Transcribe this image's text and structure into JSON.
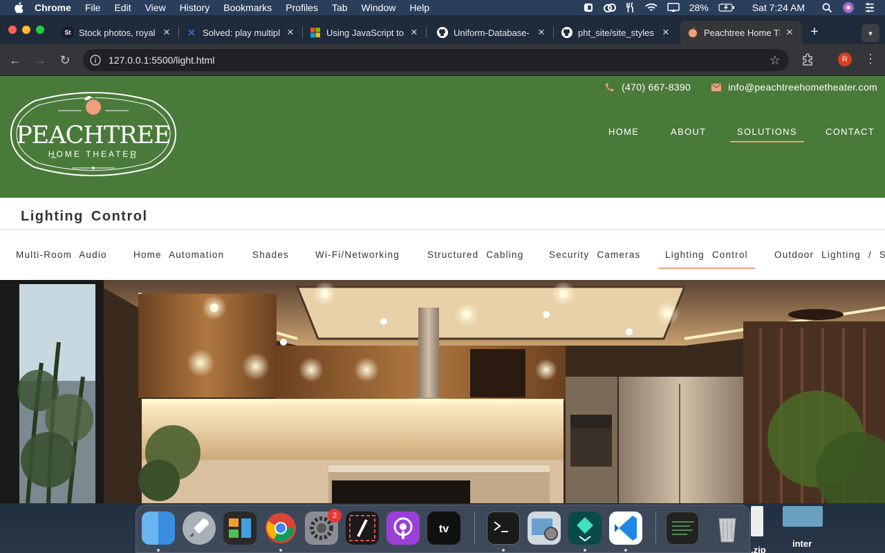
{
  "menubar": {
    "app": "Chrome",
    "menus": [
      "File",
      "Edit",
      "View",
      "History",
      "Bookmarks",
      "Profiles",
      "Tab",
      "Window",
      "Help"
    ],
    "battery": "28%",
    "clock": "Sat 7:24 AM"
  },
  "tabs": [
    {
      "title": "Stock photos, royal",
      "favicon": "St",
      "favicon_color": "#1a1a2e"
    },
    {
      "title": "Solved: play multipl",
      "favicon": "✕",
      "favicon_color": "#2a6fdb"
    },
    {
      "title": "Using JavaScript to",
      "favicon": "ms",
      "favicon_color": "#ffffff"
    },
    {
      "title": "Uniform-Database-",
      "favicon": "gh",
      "favicon_color": "#ffffff"
    },
    {
      "title": "pht_site/site_styles",
      "favicon": "gh",
      "favicon_color": "#ffffff"
    },
    {
      "title": "Peachtree Home Th",
      "favicon": "peach",
      "favicon_color": "#f0a07a"
    }
  ],
  "address": {
    "url": "127.0.0.1:5500/light.html",
    "avatar_letter": "R"
  },
  "site": {
    "logo_text_main": "PEACHTREE",
    "logo_text_sub": "HOME THEATER",
    "phone": "(470) 667-8390",
    "email": "info@peachtreehometheater.com",
    "nav": [
      "HOME",
      "ABOUT",
      "SOLUTIONS",
      "CONTACT"
    ],
    "active_nav": "SOLUTIONS",
    "page_title": "Lighting Control",
    "subnav": [
      "Multi-Room Audio",
      "Home Automation",
      "Shades",
      "Wi-Fi/Networking",
      "Structured Cabling",
      "Security Cameras",
      "Lighting Control",
      "Outdoor Lighting / So"
    ],
    "active_subnav": "Lighting Control",
    "header_color": "#4a7a3a",
    "accent_color": "#f0a07a"
  },
  "dock": {
    "settings_badge": "2",
    "files": [
      ".zip",
      "inter"
    ]
  }
}
